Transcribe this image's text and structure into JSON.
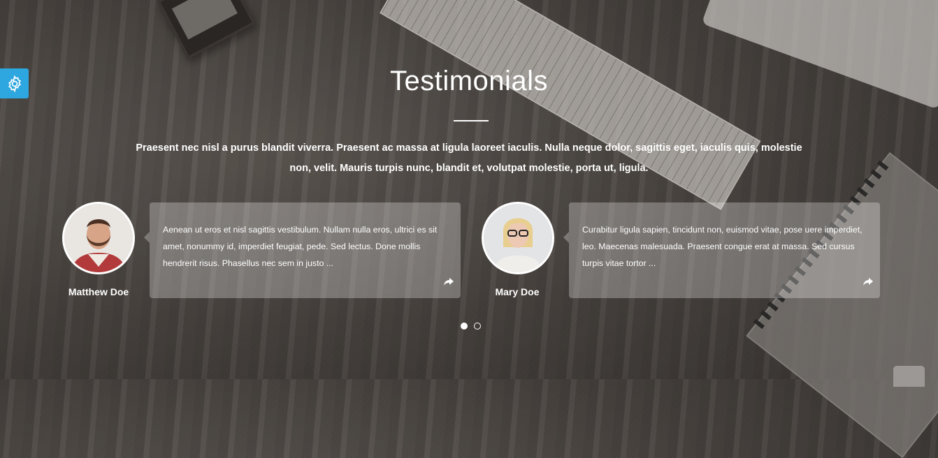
{
  "section": {
    "title": "Testimonials",
    "intro": "Praesent nec nisl a purus blandit viverra. Praesent ac massa at ligula laoreet iaculis. Nulla neque dolor, sagittis eget, iaculis quis, molestie non, velit. Mauris turpis nunc, blandit et, volutpat molestie, porta ut, ligula."
  },
  "testimonials": [
    {
      "name": "Matthew Doe",
      "quote": "Aenean ut eros et nisl sagittis vestibulum. Nullam nulla eros, ultrici es sit amet, nonummy id, imperdiet feugiat, pede. Sed lectus. Done mollis hendrerit risus. Phasellus nec sem in justo ...",
      "avatar_icon": "man-bearded-avatar",
      "share_icon": "share-arrow-icon"
    },
    {
      "name": "Mary Doe",
      "quote": "Curabitur ligula sapien, tincidunt non, euismod vitae, pose uere imperdiet, leo. Maecenas malesuada. Praesent congue erat at massa. Sed cursus turpis vitae tortor ...",
      "avatar_icon": "woman-glasses-avatar",
      "share_icon": "share-arrow-icon"
    }
  ],
  "pagination": {
    "pages": 2,
    "active": 1
  },
  "colors": {
    "accent": "#2ea6df",
    "text": "#ffffff"
  },
  "settings_icon": "gear-icon"
}
